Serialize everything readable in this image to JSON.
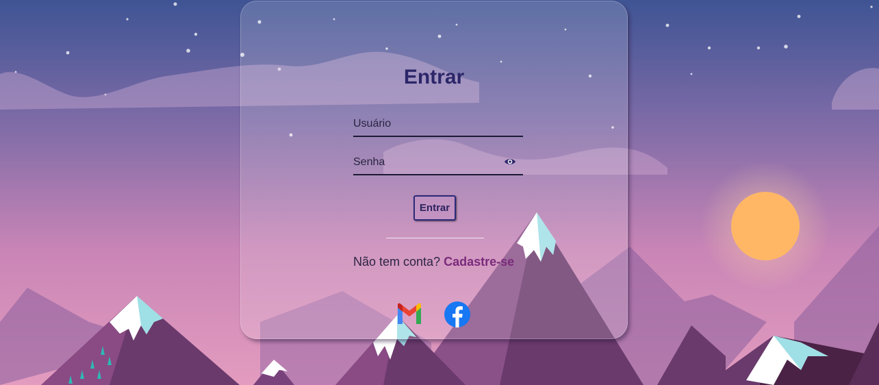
{
  "login": {
    "title": "Entrar",
    "username_placeholder": "Usuário",
    "password_placeholder": "Senha",
    "submit_label": "Entrar",
    "signup_prompt": "Não tem conta?",
    "signup_link": "Cadastre-se"
  },
  "social": [
    {
      "name": "Gmail",
      "icon": "gmail-icon"
    },
    {
      "name": "Facebook",
      "icon": "facebook-icon"
    }
  ],
  "colors": {
    "title": "#2c2669",
    "signup_link": "#7a2b7a",
    "sun": "#ffb766",
    "sky_top": "#3f5494",
    "sky_bottom": "#d386b8"
  }
}
